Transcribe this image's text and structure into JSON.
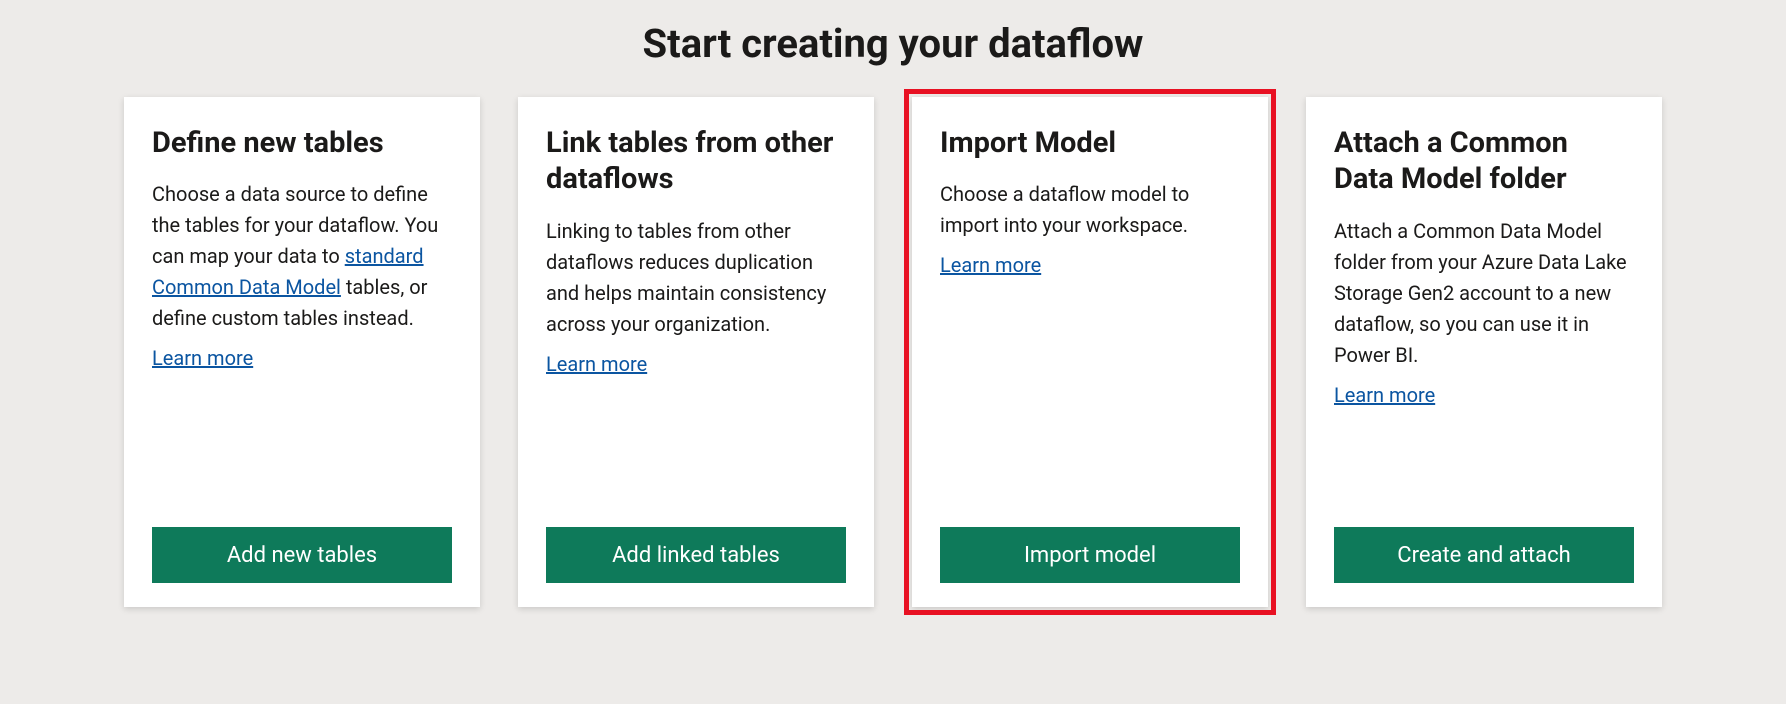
{
  "title": "Start creating your dataflow",
  "cards": [
    {
      "title": "Define new tables",
      "desc_pre": "Choose a data source to define the tables for your dataflow. You can map your data to ",
      "desc_link": "standard Common Data Model",
      "desc_post": " tables, or define custom tables instead.",
      "learn_more": "Learn more",
      "button": "Add new tables"
    },
    {
      "title": "Link tables from other dataflows",
      "desc_pre": "Linking to tables from other dataflows reduces duplication and helps maintain consistency across your organization.",
      "desc_link": "",
      "desc_post": "",
      "learn_more": "Learn more",
      "button": "Add linked tables"
    },
    {
      "title": "Import Model",
      "desc_pre": "Choose a dataflow model to import into your workspace.",
      "desc_link": "",
      "desc_post": "",
      "learn_more": "Learn more",
      "button": "Import model"
    },
    {
      "title": "Attach a Common Data Model folder",
      "desc_pre": "Attach a Common Data Model folder from your Azure Data Lake Storage Gen2 account to a new dataflow, so you can use it in Power BI.",
      "desc_link": "",
      "desc_post": "",
      "learn_more": "Learn more",
      "button": "Create and attach"
    }
  ]
}
